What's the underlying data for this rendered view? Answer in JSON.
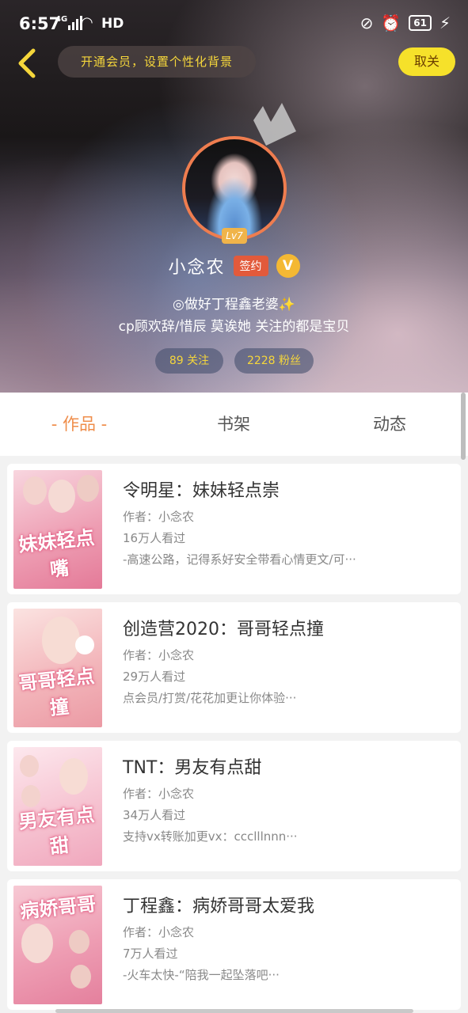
{
  "status_bar": {
    "time": "6:57",
    "network": "4G",
    "hd": "HD",
    "battery": "61"
  },
  "header": {
    "vip_banner": "开通会员，设置个性化背景",
    "cancel_label": "取关"
  },
  "profile": {
    "level": "Lv7",
    "username": "小念农",
    "sign_badge": "签约",
    "v_badge": "V",
    "bio_line1": "◎做好丁程鑫老婆✨",
    "bio_line2": "cp顾欢辞/惜辰 莫诶她 关注的都是宝贝",
    "follow": "89 关注",
    "fans": "2228 粉丝"
  },
  "tabs": {
    "works": "- 作品 -",
    "shelf": "书架",
    "dynamic": "动态"
  },
  "books": [
    {
      "title": "令明星：妹妹轻点崇",
      "author": "作者：小念农",
      "views": "16万人看过",
      "desc": "-高速公路，记得系好安全带看心情更文/可···",
      "cover_text": "妹妹轻点嘴",
      "cover_color": "#f4b3c3"
    },
    {
      "title": "创造营2020：哥哥轻点撞",
      "author": "作者：小念农",
      "views": "29万人看过",
      "desc": "点会员/打赏/花花加更让你体验···",
      "cover_text": "哥哥轻点撞",
      "cover_color": "#f7c6c8"
    },
    {
      "title": "TNT：男友有点甜",
      "author": "作者：小念农",
      "views": "34万人看过",
      "desc": "支持vx转账加更vx：ccclllnnn···",
      "cover_text": "男友有点甜",
      "cover_color": "#f6d0da"
    },
    {
      "title": "丁程鑫：病娇哥哥太爱我",
      "author": "作者：小念农",
      "views": "7万人看过",
      "desc": "-火车太快-“陪我一起坠落吧···",
      "cover_text": "病娇哥哥",
      "cover_color": "#f2a9bd"
    }
  ]
}
